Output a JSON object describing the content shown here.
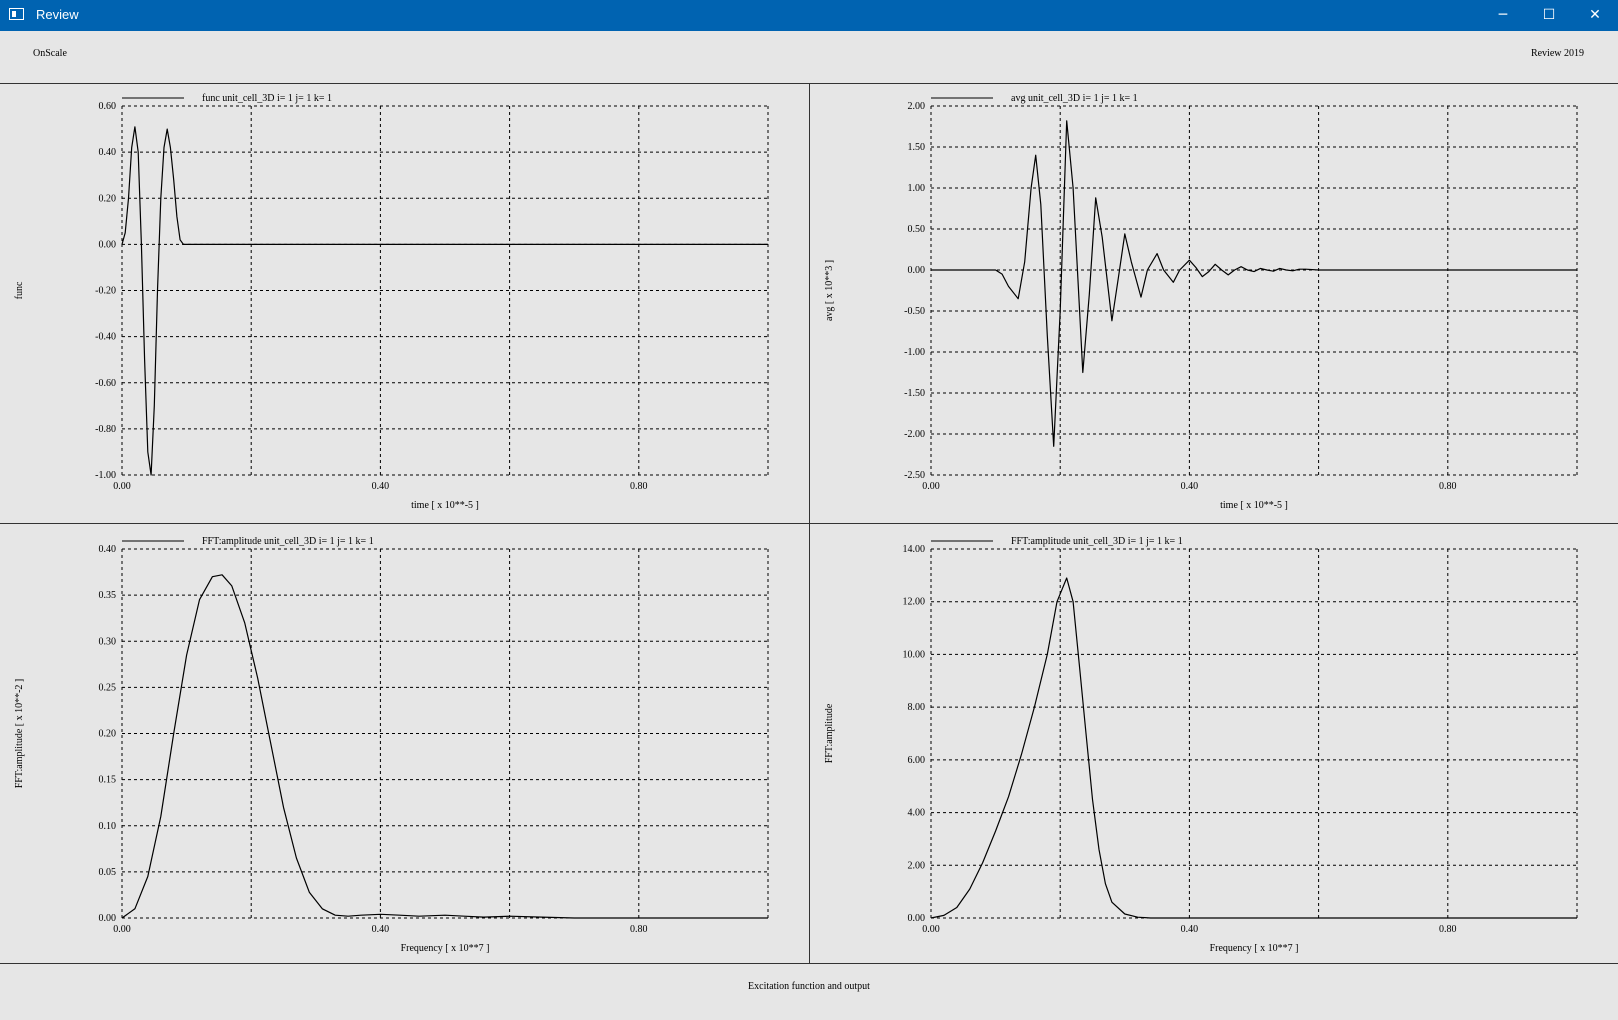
{
  "window": {
    "title": "Review"
  },
  "header": {
    "left_label": "OnScale",
    "right_label": "Review 2019"
  },
  "footer": {
    "caption": "Excitation function and output"
  },
  "chart_data": [
    {
      "type": "line",
      "legend": "func unit_cell_3D i= 1 j= 1 k= 1",
      "xlabel": "time [ x 10**-5 ]",
      "ylabel": "func",
      "xlim": [
        0,
        1.0
      ],
      "ylim": [
        -1.0,
        0.6
      ],
      "xticks": [
        0.0,
        0.2,
        0.4,
        0.6,
        0.8,
        1.0
      ],
      "xtick_labels": [
        "0.00",
        "",
        "0.40",
        "",
        "0.80",
        ""
      ],
      "yticks": [
        0.6,
        0.4,
        0.2,
        0.0,
        -0.2,
        -0.4,
        -0.6,
        -0.8,
        -1.0
      ],
      "ytick_labels": [
        "0.60",
        "0.40",
        "0.20",
        "0.00",
        "-0.20",
        "-0.40",
        "-0.60",
        "-0.80",
        "-1.00"
      ],
      "x": [
        0.0,
        0.005,
        0.01,
        0.015,
        0.02,
        0.025,
        0.03,
        0.035,
        0.04,
        0.045,
        0.05,
        0.055,
        0.06,
        0.065,
        0.07,
        0.075,
        0.08,
        0.085,
        0.09,
        0.095,
        0.1,
        0.15,
        0.3,
        0.5,
        0.7,
        0.9,
        1.0
      ],
      "y": [
        0.0,
        0.05,
        0.2,
        0.42,
        0.51,
        0.4,
        0.0,
        -0.5,
        -0.9,
        -1.0,
        -0.7,
        -0.2,
        0.2,
        0.42,
        0.5,
        0.42,
        0.28,
        0.12,
        0.02,
        0.0,
        0.0,
        0.0,
        0.0,
        0.0,
        0.0,
        0.0,
        0.0
      ]
    },
    {
      "type": "line",
      "legend": "avg unit_cell_3D i= 1 j= 1 k= 1",
      "xlabel": "time [ x 10**-5 ]",
      "ylabel": "avg [ x 10**3 ]",
      "xlim": [
        0,
        1.0
      ],
      "ylim": [
        -2.5,
        2.0
      ],
      "xticks": [
        0.0,
        0.2,
        0.4,
        0.6,
        0.8,
        1.0
      ],
      "xtick_labels": [
        "0.00",
        "",
        "0.40",
        "",
        "0.80",
        ""
      ],
      "yticks": [
        2.0,
        1.5,
        1.0,
        0.5,
        0.0,
        -0.5,
        -1.0,
        -1.5,
        -2.0,
        -2.5
      ],
      "ytick_labels": [
        "2.00",
        "1.50",
        "1.00",
        "0.50",
        "0.00",
        "-0.50",
        "-1.00",
        "-1.50",
        "-2.00",
        "-2.50"
      ],
      "x": [
        0.0,
        0.1,
        0.11,
        0.12,
        0.135,
        0.145,
        0.155,
        0.162,
        0.17,
        0.18,
        0.19,
        0.2,
        0.21,
        0.22,
        0.23,
        0.235,
        0.245,
        0.255,
        0.265,
        0.28,
        0.29,
        0.3,
        0.31,
        0.325,
        0.335,
        0.35,
        0.36,
        0.375,
        0.385,
        0.4,
        0.41,
        0.42,
        0.43,
        0.44,
        0.45,
        0.46,
        0.47,
        0.48,
        0.49,
        0.5,
        0.51,
        0.52,
        0.53,
        0.54,
        0.55,
        0.56,
        0.57,
        0.58,
        0.6,
        1.0
      ],
      "y": [
        0.0,
        0.0,
        -0.05,
        -0.2,
        -0.35,
        0.1,
        1.0,
        1.4,
        0.8,
        -0.8,
        -2.15,
        -0.5,
        1.82,
        1.0,
        -0.5,
        -1.25,
        -0.3,
        0.88,
        0.4,
        -0.62,
        -0.1,
        0.44,
        0.1,
        -0.33,
        0.0,
        0.2,
        0.0,
        -0.15,
        0.0,
        0.12,
        0.03,
        -0.08,
        -0.02,
        0.07,
        0.0,
        -0.06,
        0.0,
        0.04,
        0.0,
        -0.02,
        0.02,
        0.0,
        -0.015,
        0.02,
        0.0,
        -0.01,
        0.01,
        0.01,
        0.0,
        0.0
      ]
    },
    {
      "type": "line",
      "legend": "FFT:amplitude unit_cell_3D i= 1 j= 1 k= 1",
      "xlabel": "Frequency [ x 10**7 ]",
      "ylabel": "FFT:amplitude [ x 10**-2 ]",
      "xlim": [
        0,
        1.0
      ],
      "ylim": [
        0.0,
        0.4
      ],
      "xticks": [
        0.0,
        0.2,
        0.4,
        0.6,
        0.8,
        1.0
      ],
      "xtick_labels": [
        "0.00",
        "",
        "0.40",
        "",
        "0.80",
        ""
      ],
      "yticks": [
        0.4,
        0.35,
        0.3,
        0.25,
        0.2,
        0.15,
        0.1,
        0.05,
        0.0
      ],
      "ytick_labels": [
        "0.40",
        "0.35",
        "0.30",
        "0.25",
        "0.20",
        "0.15",
        "0.10",
        "0.05",
        "0.00"
      ],
      "x": [
        0.0,
        0.02,
        0.04,
        0.06,
        0.08,
        0.1,
        0.12,
        0.14,
        0.155,
        0.17,
        0.19,
        0.21,
        0.23,
        0.25,
        0.27,
        0.29,
        0.31,
        0.33,
        0.35,
        0.37,
        0.4,
        0.43,
        0.46,
        0.5,
        0.53,
        0.56,
        0.6,
        0.65,
        0.7,
        1.0
      ],
      "y": [
        0.0,
        0.01,
        0.045,
        0.11,
        0.2,
        0.285,
        0.345,
        0.37,
        0.372,
        0.36,
        0.32,
        0.26,
        0.19,
        0.12,
        0.065,
        0.028,
        0.01,
        0.003,
        0.002,
        0.003,
        0.004,
        0.003,
        0.002,
        0.003,
        0.002,
        0.001,
        0.002,
        0.001,
        0.0,
        0.0
      ]
    },
    {
      "type": "line",
      "legend": "FFT:amplitude unit_cell_3D i= 1 j= 1 k= 1",
      "xlabel": "Frequency [ x 10**7 ]",
      "ylabel": "FFT:amplitude",
      "xlim": [
        0,
        1.0
      ],
      "ylim": [
        0.0,
        14.0
      ],
      "xticks": [
        0.0,
        0.2,
        0.4,
        0.6,
        0.8,
        1.0
      ],
      "xtick_labels": [
        "0.00",
        "",
        "0.40",
        "",
        "0.80",
        ""
      ],
      "yticks": [
        14.0,
        12.0,
        10.0,
        8.0,
        6.0,
        4.0,
        2.0,
        0.0
      ],
      "ytick_labels": [
        "14.00",
        "12.00",
        "10.00",
        "8.00",
        "6.00",
        "4.00",
        "2.00",
        "0.00"
      ],
      "x": [
        0.0,
        0.02,
        0.04,
        0.06,
        0.08,
        0.1,
        0.12,
        0.14,
        0.16,
        0.18,
        0.195,
        0.21,
        0.22,
        0.23,
        0.24,
        0.25,
        0.26,
        0.27,
        0.28,
        0.3,
        0.32,
        0.34,
        0.4,
        0.6,
        1.0
      ],
      "y": [
        0.0,
        0.1,
        0.4,
        1.1,
        2.1,
        3.3,
        4.6,
        6.2,
        8.0,
        10.0,
        12.0,
        12.9,
        12.0,
        9.5,
        7.0,
        4.5,
        2.6,
        1.3,
        0.6,
        0.15,
        0.03,
        0.0,
        0.0,
        0.0,
        0.0
      ]
    }
  ]
}
